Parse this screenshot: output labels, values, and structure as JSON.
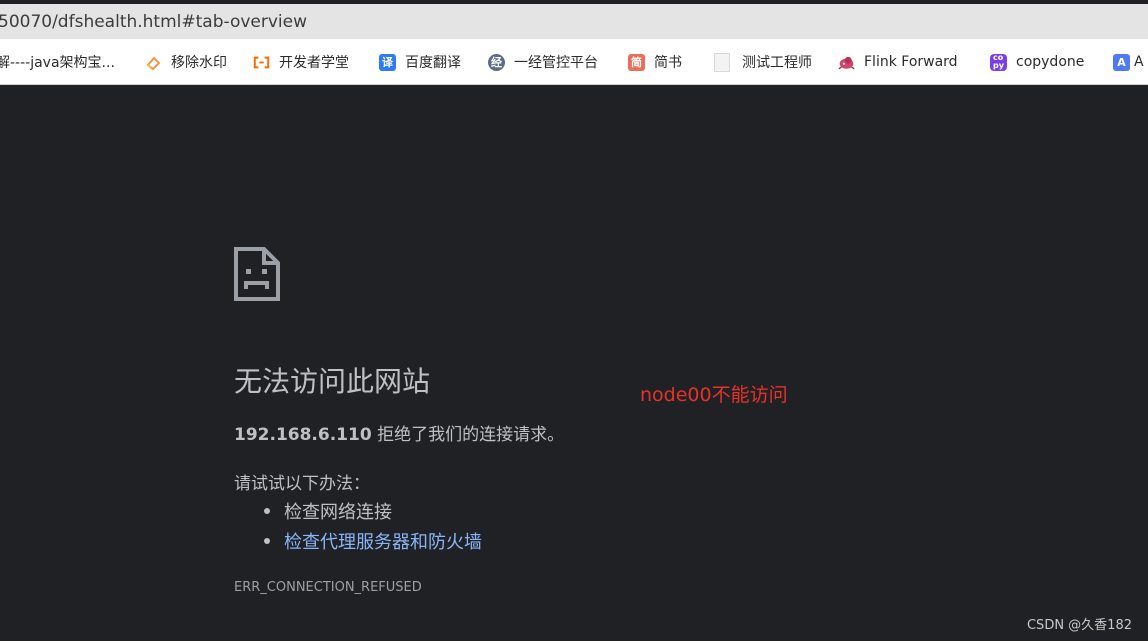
{
  "address_bar": {
    "url": "50070/dfshealth.html#tab-overview"
  },
  "bookmarks": [
    {
      "label": "解----java架构宝...",
      "icon": "article-icon",
      "color": "#ffffff"
    },
    {
      "label": "移除水印",
      "icon": "eraser-icon",
      "color": "#ff8a3d"
    },
    {
      "label": "开发者学堂",
      "icon": "aliyun-icon",
      "color": "#ff6a00"
    },
    {
      "label": "百度翻译",
      "icon": "translate-icon",
      "color": "#2b7cf6"
    },
    {
      "label": "一经管控平台",
      "icon": "jing-icon",
      "color": "#5c6b8a"
    },
    {
      "label": "简书",
      "icon": "jianshu-icon",
      "color": "#ea6f5a"
    },
    {
      "label": "测试工程师",
      "icon": "page-icon",
      "color": "#eeeeee"
    },
    {
      "label": "Flink Forward",
      "icon": "flink-icon",
      "color": "#d3446a"
    },
    {
      "label": "copydone",
      "icon": "copydone-icon",
      "color": "#7b3fe4"
    },
    {
      "label": "A",
      "icon": "a-icon",
      "color": "#4e7cf0"
    }
  ],
  "error_page": {
    "icon": "sad-page-icon",
    "title": "无法访问此网站",
    "host": "192.168.6.110",
    "message": "拒绝了我们的连接请求。",
    "try_label": "请试试以下办法：",
    "suggestions": [
      {
        "text": "检查网络连接",
        "link": false
      },
      {
        "text": "检查代理服务器和防火墙",
        "link": true
      }
    ],
    "error_code": "ERR_CONNECTION_REFUSED"
  },
  "annotation": {
    "text": "node00不能访问",
    "color": "#e5332a"
  },
  "watermark": {
    "text": "CSDN @久香182"
  }
}
